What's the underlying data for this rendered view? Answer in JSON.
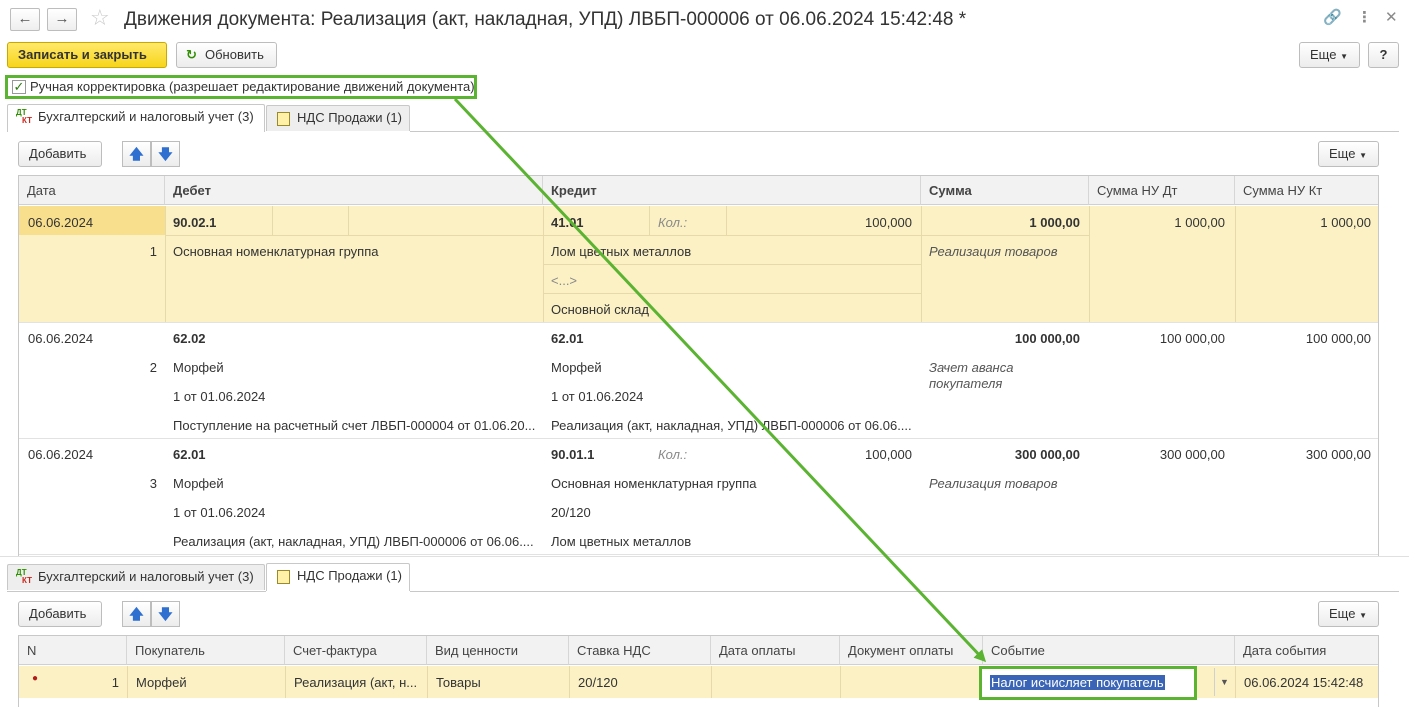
{
  "window": {
    "title": "Движения документа: Реализация (акт, накладная, УПД) ЛВБП-000006 от 06.06.2024 15:42:48 *"
  },
  "toolbar": {
    "save_close": "Записать и закрыть",
    "refresh": "Обновить",
    "more": "Еще",
    "help": "?"
  },
  "manual_correction": {
    "label": "Ручная корректировка (разрешает редактирование движений документа)",
    "checked": true
  },
  "tabs": [
    {
      "label": "Бухгалтерский и налоговый учет (3)"
    },
    {
      "label": "НДС Продажи (1)"
    }
  ],
  "accounting": {
    "add": "Добавить",
    "more": "Еще",
    "columns": [
      "Дата",
      "Дебет",
      "Кредит",
      "Сумма",
      "Сумма НУ Дт",
      "Сумма НУ Кт"
    ],
    "rows": [
      {
        "date": "06.06.2024",
        "n": "1",
        "debit": [
          "90.02.1",
          "Основная номенклатурная группа",
          "",
          ""
        ],
        "credit": [
          "41.01",
          "Лом цветных металлов",
          "<...>",
          "Основной склад"
        ],
        "qty_label": "Кол.:",
        "qty": "100,000",
        "sum": "1 000,00",
        "sum_note": "Реализация товаров",
        "nu_dt": "1 000,00",
        "nu_kt": "1 000,00"
      },
      {
        "date": "06.06.2024",
        "n": "2",
        "debit": [
          "62.02",
          "Морфей",
          "1 от 01.06.2024",
          "Поступление на расчетный счет ЛВБП-000004 от 01.06.20..."
        ],
        "credit": [
          "62.01",
          "Морфей",
          "1 от 01.06.2024",
          "Реализация (акт, накладная, УПД) ЛВБП-000006 от 06.06...."
        ],
        "qty_label": "",
        "qty": "",
        "sum": "100 000,00",
        "sum_note": "Зачет аванса покупателя",
        "nu_dt": "100 000,00",
        "nu_kt": "100 000,00"
      },
      {
        "date": "06.06.2024",
        "n": "3",
        "debit": [
          "62.01",
          "Морфей",
          "1 от 01.06.2024",
          "Реализация (акт, накладная, УПД) ЛВБП-000006 от 06.06...."
        ],
        "credit": [
          "90.01.1",
          "Основная номенклатурная группа",
          "20/120",
          "Лом цветных металлов"
        ],
        "qty_label": "Кол.:",
        "qty": "100,000",
        "sum": "300 000,00",
        "sum_note": "Реализация товаров",
        "nu_dt": "300 000,00",
        "nu_kt": "300 000,00"
      }
    ]
  },
  "vat": {
    "add": "Добавить",
    "more": "Еще",
    "columns": [
      "N",
      "Покупатель",
      "Счет-фактура",
      "Вид ценности",
      "Ставка НДС",
      "Дата оплаты",
      "Документ оплаты",
      "Событие",
      "Дата события"
    ],
    "row": {
      "n": "1",
      "buyer": "Морфей",
      "invoice": "Реализация (акт, н...",
      "value_type": "Товары",
      "rate": "20/120",
      "pay_date": "",
      "pay_doc": "",
      "event": "Налог исчисляет покупатель",
      "event_date": "06.06.2024 15:42:48"
    }
  },
  "colors": {
    "highlight": "#5bb332",
    "selected_row": "#fbf1c4",
    "primary_button": "#f7d51a",
    "selection": "#3a64b5"
  }
}
